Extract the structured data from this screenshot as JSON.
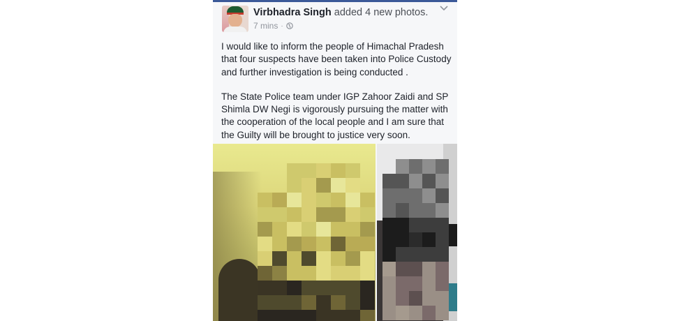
{
  "post": {
    "author": "Virbhadra Singh",
    "action": "added 4 new photos.",
    "time": "7 mins",
    "separator": "·",
    "audience_icon": "globe-icon",
    "menu_icon": "chevron-down-icon",
    "paragraphs": [
      "I would like to inform the people of Himachal Pradesh that four suspects have been taken into Police Custody and further investigation is being conducted .",
      "The State Police team under IGP Zahoor Zaidi  and SP Shimla DW Negi is vigorously pursuing the matter with the cooperation of the local people and I am sure that the Guilty will be brought to justice very soon."
    ],
    "photos": [
      "pixelated-photo-1",
      "pixelated-photo-2"
    ]
  },
  "colors": {
    "brand": "#3b5998",
    "author_text": "#1d2129",
    "meta_text": "#90949c",
    "card_background": "#f6f7f9"
  }
}
